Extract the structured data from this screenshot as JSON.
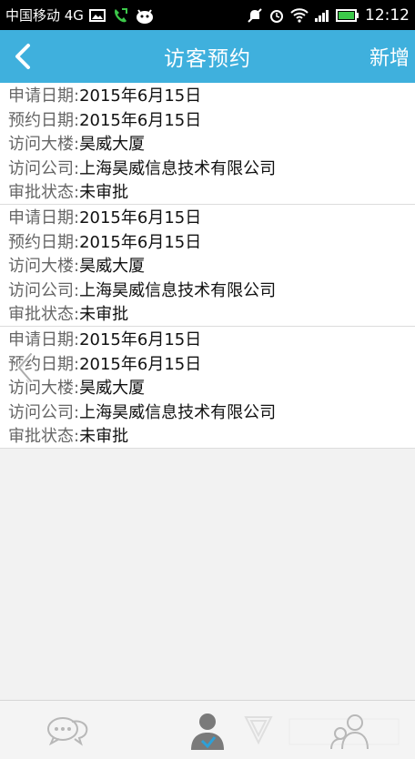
{
  "status_bar": {
    "carrier": "中国移动 4G",
    "time": "12:12",
    "icons": [
      "image-icon",
      "phone-icon",
      "android-icon",
      "mute-icon",
      "alarm-icon",
      "wifi-icon",
      "signal-icon",
      "battery-icon"
    ]
  },
  "header": {
    "title": "访客预约",
    "add_label": "新增",
    "background": "#3fb0dd"
  },
  "labels": {
    "apply_date": "申请日期:",
    "book_date": "预约日期:",
    "building": "访问大楼:",
    "company": "访问公司:",
    "status": "审批状态:"
  },
  "records": [
    {
      "apply_date": "2015年6月15日",
      "book_date": "2015年6月15日",
      "building": "昊威大厦",
      "company": "上海昊威信息技术有限公司",
      "status": "未审批"
    },
    {
      "apply_date": "2015年6月15日",
      "book_date": "2015年6月15日",
      "building": "昊威大厦",
      "company": "上海昊威信息技术有限公司",
      "status": "未审批"
    },
    {
      "apply_date": "2015年6月15日",
      "book_date": "2015年6月15日",
      "building": "昊威大厦",
      "company": "上海昊威信息技术有限公司",
      "status": "未审批"
    }
  ],
  "bottom_nav": {
    "items": [
      "chat-bubbles-icon",
      "user-icon",
      "contacts-icon"
    ]
  }
}
